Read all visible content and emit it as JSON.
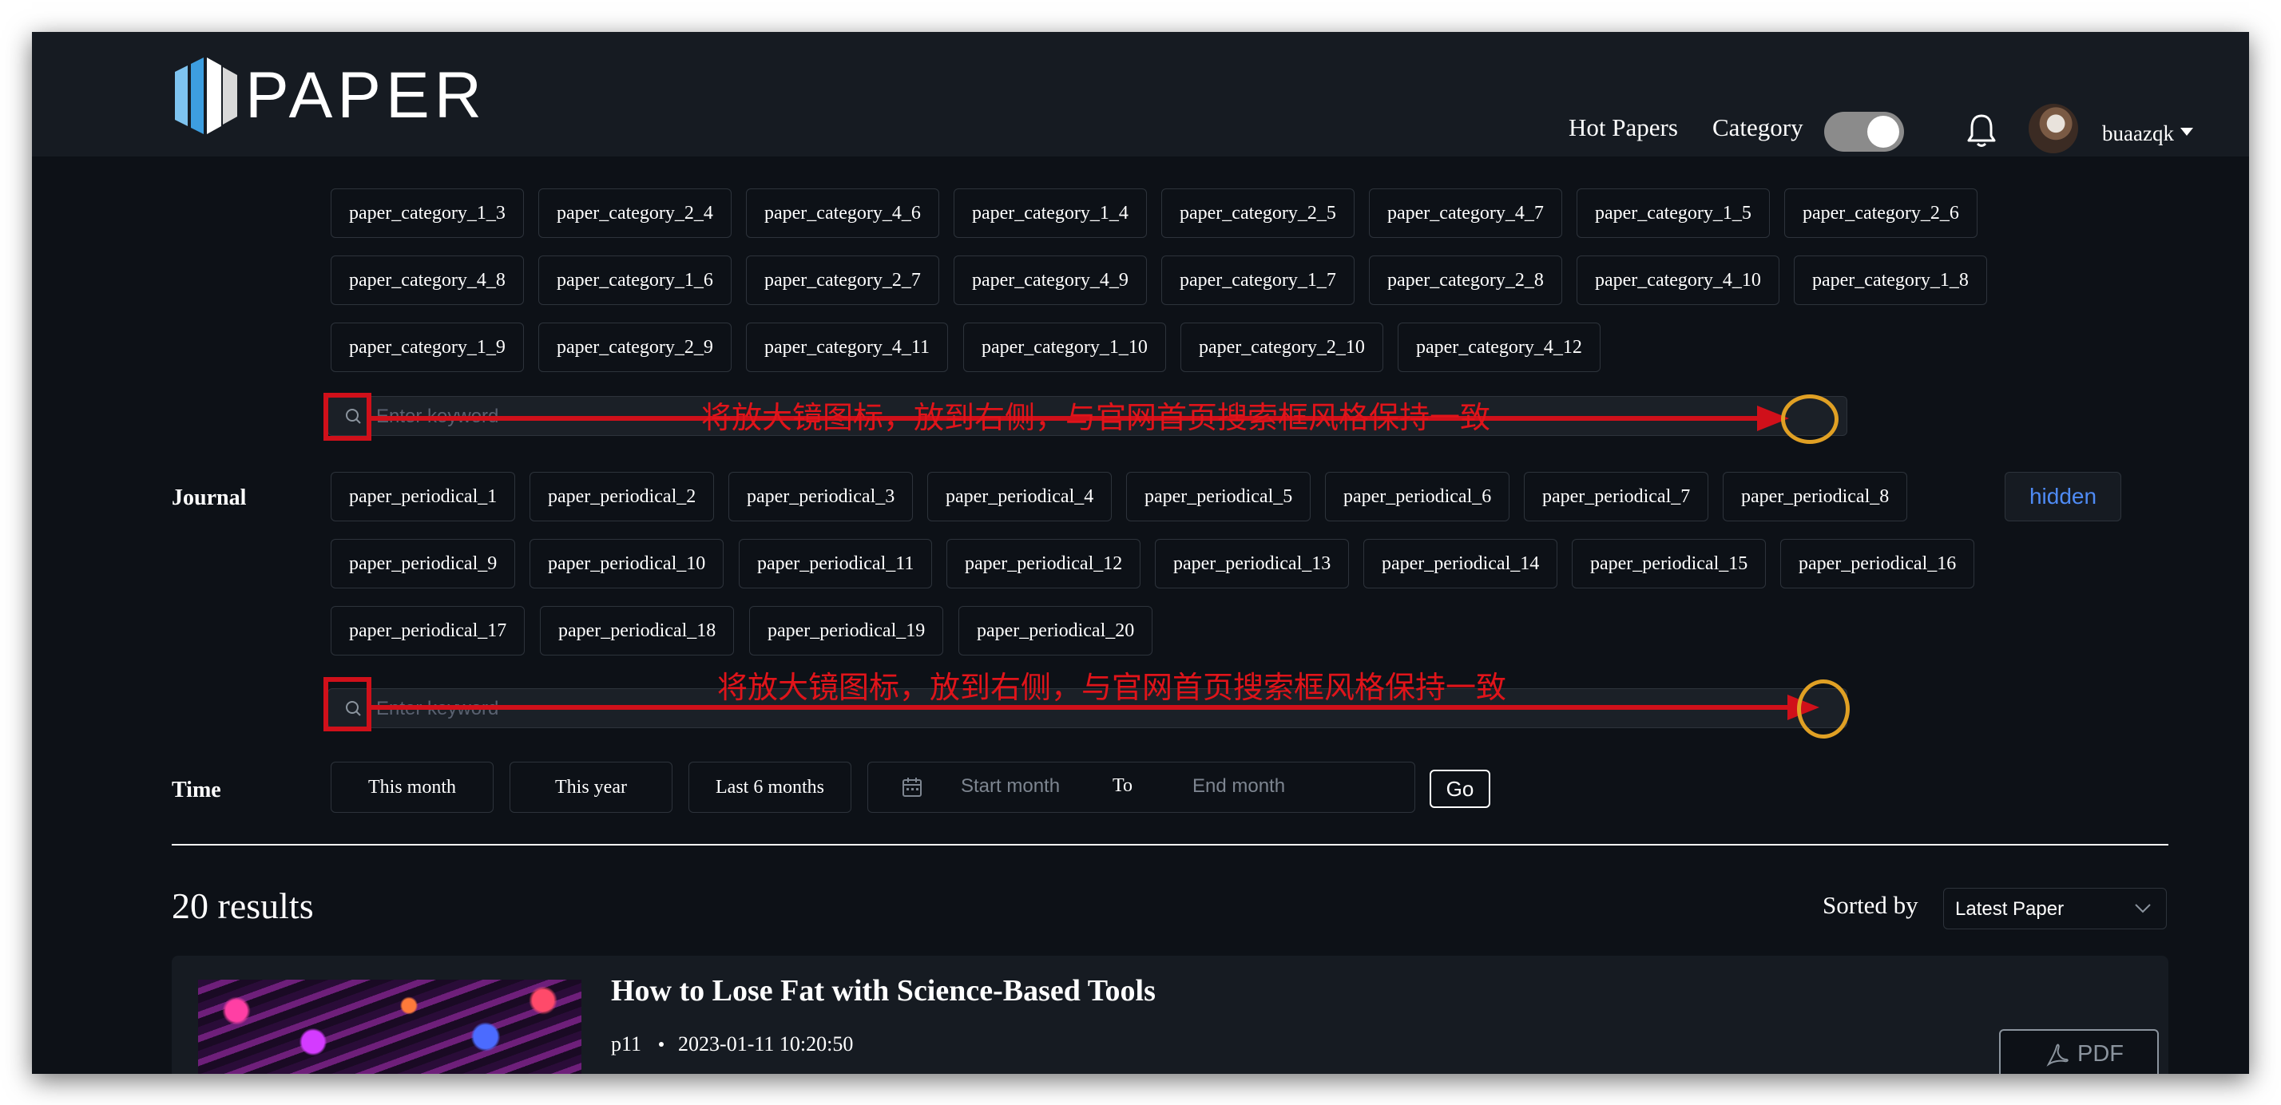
{
  "app": {
    "logo_text": "PAPER"
  },
  "nav": {
    "hot_papers": "Hot Papers",
    "category": "Category",
    "username": "buaazqk"
  },
  "categories": {
    "row1": [
      "paper_category_1_3",
      "paper_category_2_4",
      "paper_category_4_6",
      "paper_category_1_4",
      "paper_category_2_5",
      "paper_category_4_7",
      "paper_category_1_5",
      "paper_category_2_6"
    ],
    "row2": [
      "paper_category_4_8",
      "paper_category_1_6",
      "paper_category_2_7",
      "paper_category_4_9",
      "paper_category_1_7",
      "paper_category_2_8",
      "paper_category_4_10",
      "paper_category_1_8"
    ],
    "row3": [
      "paper_category_1_9",
      "paper_category_2_9",
      "paper_category_4_11",
      "paper_category_1_10",
      "paper_category_2_10",
      "paper_category_4_12"
    ],
    "search_placeholder": "Enter keyword"
  },
  "journal": {
    "label": "Journal",
    "hidden_label": "hidden",
    "row1": [
      "paper_periodical_1",
      "paper_periodical_2",
      "paper_periodical_3",
      "paper_periodical_4",
      "paper_periodical_5",
      "paper_periodical_6",
      "paper_periodical_7",
      "paper_periodical_8"
    ],
    "row2": [
      "paper_periodical_9",
      "paper_periodical_10",
      "paper_periodical_11",
      "paper_periodical_12",
      "paper_periodical_13",
      "paper_periodical_14",
      "paper_periodical_15",
      "paper_periodical_16"
    ],
    "row3": [
      "paper_periodical_17",
      "paper_periodical_18",
      "paper_periodical_19",
      "paper_periodical_20"
    ],
    "search_placeholder": "Enter keyword"
  },
  "time": {
    "label": "Time",
    "options": [
      "This month",
      "This year",
      "Last 6 months"
    ],
    "start_placeholder": "Start month",
    "to_label": "To",
    "end_placeholder": "End month",
    "go_label": "Go"
  },
  "results": {
    "count_text": "20 results",
    "sorted_label": "Sorted by",
    "sort_value": "Latest Paper"
  },
  "paper": {
    "title": "How to Lose Fat with Science-Based Tools",
    "author": "p11",
    "date": "2023-01-11 10:20:50",
    "pdf_label": "PDF"
  },
  "annotation": {
    "note": "将放大镜图标，放到右侧，与官网首页搜索框风格保持一致",
    "color": "#e0141a"
  },
  "colors": {
    "background": "#0d1117",
    "navbar": "#161b22",
    "accent_link": "#4f8bf5"
  }
}
